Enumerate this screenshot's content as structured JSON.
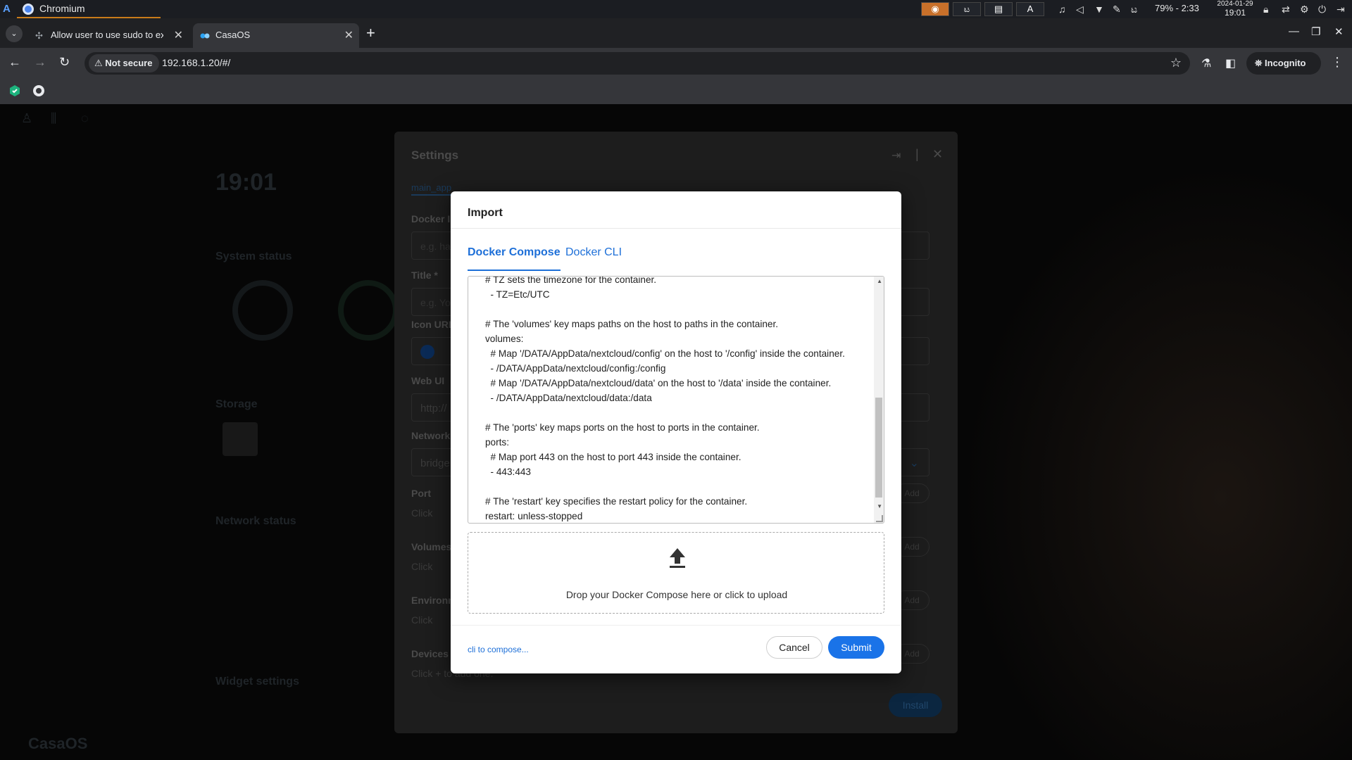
{
  "os": {
    "task_label": "Chromium",
    "battery": "79% - 2:33",
    "date": "2024-01-29",
    "time": "19:01"
  },
  "browser": {
    "tabs": [
      {
        "title": "Allow user to use sudo to ex"
      },
      {
        "title": "CasaOS"
      }
    ],
    "security_label": "Not secure",
    "url": "192.168.1.20/#/",
    "incognito_label": "Incognito"
  },
  "settings": {
    "title": "Settings",
    "tab": "main_app",
    "labels": {
      "docker_image": "Docker Im",
      "title": "Title *",
      "icon_url": "Icon URL",
      "web_ui": "Web UI",
      "network": "Network",
      "port": "Port",
      "volumes": "Volumes",
      "environment": "Environm",
      "devices": "Devices"
    },
    "placeholder_docker": "e.g. ha",
    "placeholder_title": "e.g. Yo",
    "web_ui_value": "http://",
    "network_value": "bridge",
    "click_hint": "Click",
    "devices_hint": "Click + to add one.",
    "add_label": "Add",
    "install_label": "Install"
  },
  "background": {
    "clock": "19:01",
    "system_status": "System status",
    "storage": "Storage",
    "network_status": "Network status",
    "widget_settings": "Widget settings",
    "footer": "CasaOS"
  },
  "import_dialog": {
    "title": "Import",
    "tabs": [
      "Docker Compose",
      "Docker CLI"
    ],
    "code": "# TZ sets the timezone for the container.\n  - TZ=Etc/UTC\n\n# The 'volumes' key maps paths on the host to paths in the container.\nvolumes:\n  # Map '/DATA/AppData/nextcloud/config' on the host to '/config' inside the container.\n  - /DATA/AppData/nextcloud/config:/config\n  # Map '/DATA/AppData/nextcloud/data' on the host to '/data' inside the container.\n  - /DATA/AppData/nextcloud/data:/data\n\n# The 'ports' key maps ports on the host to ports in the container.\nports:\n  # Map port 443 on the host to port 443 inside the container.\n  - 443:443\n\n# The 'restart' key specifies the restart policy for the container.\nrestart: unless-stopped",
    "drop_text": "Drop your Docker Compose here or click to upload",
    "cli_link": "cli to compose...",
    "cancel": "Cancel",
    "submit": "Submit",
    "colors": {
      "accent": "#1a73e8"
    }
  }
}
